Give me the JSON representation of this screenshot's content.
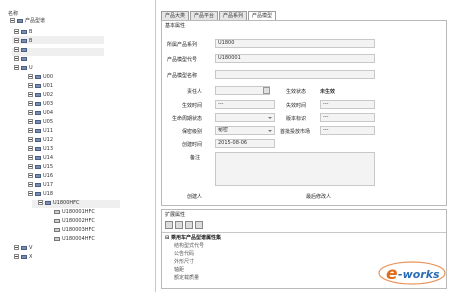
{
  "tree": {
    "header": "名称",
    "root_label": "产品型谱",
    "rows": [
      {
        "label": "B",
        "indent": 0,
        "kind": "folder"
      },
      {
        "label": "B",
        "indent": 0,
        "kind": "folder"
      },
      {
        "label": "",
        "indent": 0,
        "kind": "folder"
      },
      {
        "label": "",
        "indent": 0,
        "kind": "folder"
      },
      {
        "label": "U",
        "indent": 0,
        "kind": "folder"
      },
      {
        "label": "U00",
        "indent": 1,
        "kind": "folder"
      },
      {
        "label": "U01",
        "indent": 1,
        "kind": "folder"
      },
      {
        "label": "U02",
        "indent": 1,
        "kind": "folder"
      },
      {
        "label": "U03",
        "indent": 1,
        "kind": "folder"
      },
      {
        "label": "U04",
        "indent": 1,
        "kind": "folder"
      },
      {
        "label": "U05",
        "indent": 1,
        "kind": "folder"
      },
      {
        "label": "U11",
        "indent": 1,
        "kind": "folder"
      },
      {
        "label": "U12",
        "indent": 1,
        "kind": "folder"
      },
      {
        "label": "U13",
        "indent": 1,
        "kind": "folder"
      },
      {
        "label": "U14",
        "indent": 1,
        "kind": "folder"
      },
      {
        "label": "U15",
        "indent": 1,
        "kind": "folder"
      },
      {
        "label": "U16",
        "indent": 1,
        "kind": "folder"
      },
      {
        "label": "U17",
        "indent": 1,
        "kind": "folder"
      },
      {
        "label": "U18",
        "indent": 1,
        "kind": "folder"
      },
      {
        "label": "U1800HFC",
        "indent": 2,
        "kind": "folder"
      },
      {
        "label": "U180001HFC",
        "indent": 3,
        "kind": "item"
      },
      {
        "label": "U180002HFC",
        "indent": 3,
        "kind": "item"
      },
      {
        "label": "U180003HFC",
        "indent": 3,
        "kind": "item"
      },
      {
        "label": "U180004HFC",
        "indent": 3,
        "kind": "item"
      },
      {
        "label": "V",
        "indent": 0,
        "kind": "folder"
      },
      {
        "label": "X",
        "indent": 0,
        "kind": "folder"
      }
    ]
  },
  "tabs": [
    "产品大类",
    "产品平台",
    "产品系列",
    "产品模型"
  ],
  "basic": {
    "title": "基本属性",
    "series_label": "所属产品系列",
    "series_value": "U1800",
    "model_code_label": "产品模型代号",
    "model_code_value": "U180001",
    "model_name_label": "产品模型名称",
    "model_name_value": "",
    "owner_label": "责任人",
    "state_label": "生效状态",
    "state_value": "未生效",
    "effective_label": "生效时间",
    "effective_value": "---",
    "invalid_label": "失效时间",
    "invalid_value": "---",
    "lifecycle_label": "生命周期状态",
    "version_label": "版本标识",
    "version_value": "---",
    "secret_label": "保密级别",
    "secret_value": "秘密",
    "market_label": "首批投放市场",
    "market_value": "---",
    "created_label": "创建时间",
    "created_value": "2015-08-06",
    "remark_label": "备注",
    "creator_label": "创建人",
    "modifier_label": "最后修改人"
  },
  "ext": {
    "title": "扩展属性",
    "group_title": "乘用车产品型谱属性集",
    "rows": [
      "结构型式代号",
      "公告代码",
      "外形尺寸",
      "轴距",
      "额定载质量"
    ]
  },
  "watermark": {
    "text": "e-works",
    "color_e": "#e06a1a",
    "color_text": "#2a6db5"
  }
}
